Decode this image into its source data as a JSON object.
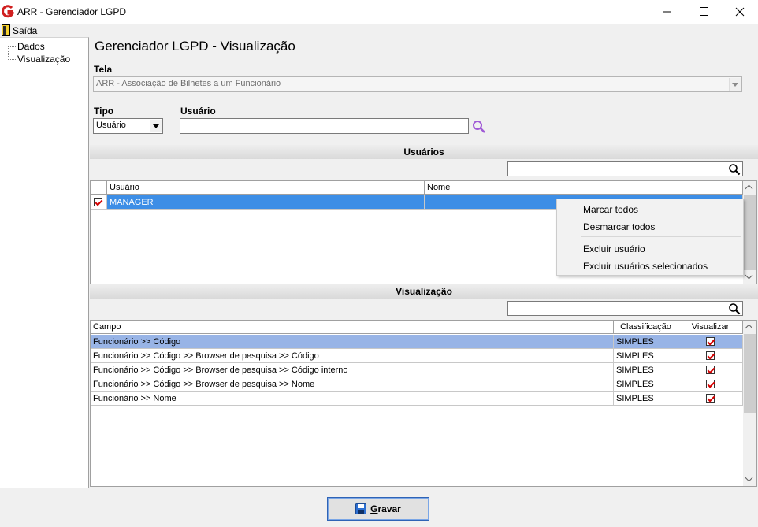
{
  "window": {
    "title": "ARR - Gerenciador LGPD",
    "minimize_glyph": "—",
    "maximize_glyph": "☐",
    "close_glyph": "✕"
  },
  "menu": {
    "exit_label": "Saída",
    "exit_icon": "door-exit-icon"
  },
  "tree": {
    "items": [
      "Dados",
      "Visualização"
    ]
  },
  "page_title": "Gerenciador LGPD - Visualização",
  "tela": {
    "label": "Tela",
    "value": "ARR - Associação de Bilhetes a um Funcionário"
  },
  "tipo": {
    "label": "Tipo",
    "value": "Usuário"
  },
  "usuario_field": {
    "label": "Usuário",
    "value": ""
  },
  "users_section": {
    "title": "Usuários",
    "search_value": "",
    "columns": [
      "Usuário",
      "Nome"
    ],
    "rows": [
      {
        "checked": true,
        "usuario": "MANAGER",
        "nome": ""
      }
    ]
  },
  "context_menu": {
    "items": [
      "Marcar todos",
      "Desmarcar todos",
      "Excluir usuário",
      "Excluir usuários selecionados"
    ]
  },
  "view_section": {
    "title": "Visualização",
    "search_value": "",
    "columns": [
      "Campo",
      "Classificação",
      "Visualizar"
    ],
    "rows": [
      {
        "campo": "Funcionário >> Código",
        "classificacao": "SIMPLES",
        "visualizar": true
      },
      {
        "campo": "Funcionário >> Código >> Browser de pesquisa >> Código",
        "classificacao": "SIMPLES",
        "visualizar": true
      },
      {
        "campo": "Funcionário >> Código >> Browser de pesquisa >> Código interno",
        "classificacao": "SIMPLES",
        "visualizar": true
      },
      {
        "campo": "Funcionário >> Código >> Browser de pesquisa >> Nome",
        "classificacao": "SIMPLES",
        "visualizar": true
      },
      {
        "campo": "Funcionário >> Nome",
        "classificacao": "SIMPLES",
        "visualizar": true
      }
    ]
  },
  "save_button": {
    "label": "Gravar",
    "icon": "floppy-disk-icon"
  },
  "colors": {
    "selection": "#3d8ee6",
    "selection_light": "#98b4e6",
    "check": "#d40000",
    "accent": "#2f63b5"
  }
}
